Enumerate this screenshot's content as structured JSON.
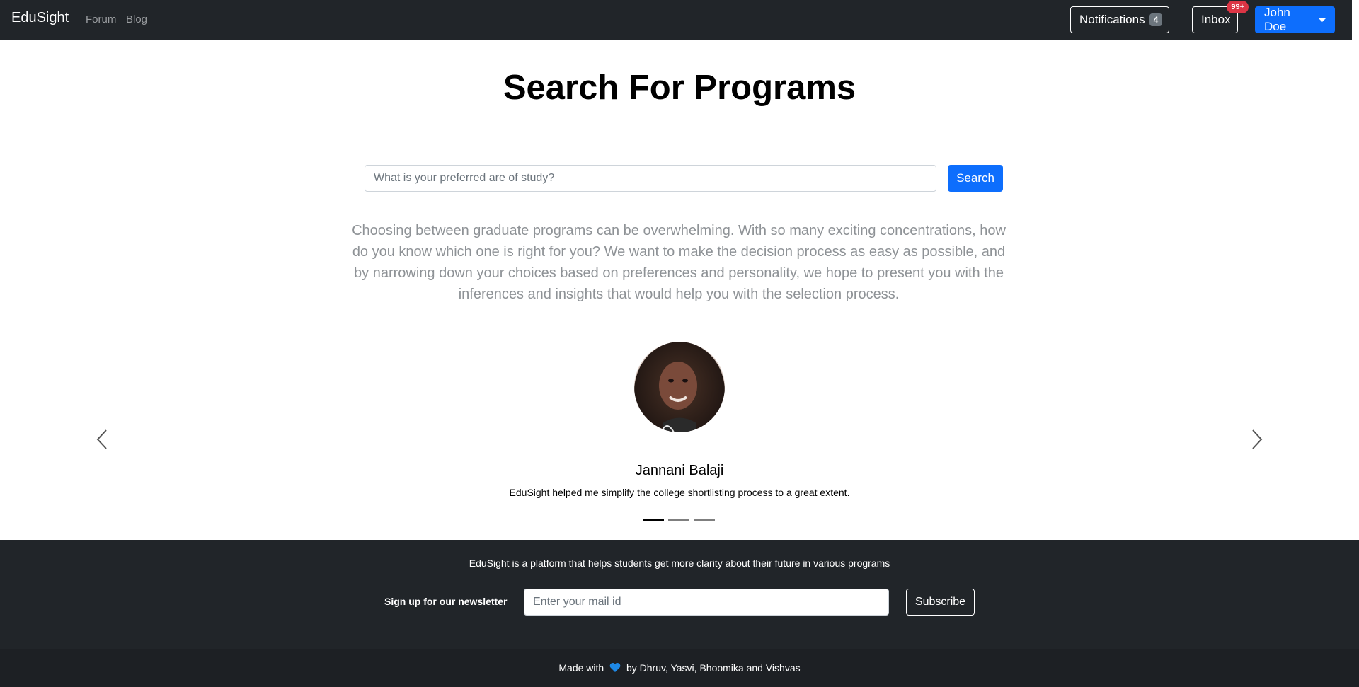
{
  "navbar": {
    "brand": "EduSight",
    "links": [
      "Forum",
      "Blog"
    ],
    "notifications_label": "Notifications",
    "notifications_count": "4",
    "inbox_label": "Inbox",
    "inbox_badge": "99+",
    "user_label": "John Doe"
  },
  "main": {
    "title": "Search For Programs",
    "search_placeholder": "What is your preferred are of study?",
    "search_button": "Search",
    "intro": "Choosing between graduate programs can be overwhelming. With so many exciting concentrations, how do you know which one is right for you? We want to make the decision process as easy as possible, and by narrowing down your choices based on preferences and personality, we hope to present you with the inferences and insights that would help you with the selection process."
  },
  "testimonial": {
    "name": "Jannani Balaji",
    "quote": "EduSight helped me simplify the college shortlisting process to a great extent.",
    "slide_count": 3,
    "active_slide": 1
  },
  "footer": {
    "tagline": "EduSight is a platform that helps students get more clarity about their future in various programs",
    "newsletter_label": "Sign up for our newsletter",
    "mail_placeholder": "Enter your mail id",
    "subscribe_button": "Subscribe",
    "credits_prefix": "Made with",
    "credits_suffix": "by Dhruv, Yasvi, Bhoomika and Vishvas"
  },
  "colors": {
    "navbar_bg": "#212529",
    "primary": "#0d6efd",
    "danger_badge": "#dc3545",
    "heart": "#1e88e5"
  },
  "icons": [
    "chevron-left-icon",
    "chevron-right-icon",
    "heart-icon",
    "caret-down-icon"
  ]
}
